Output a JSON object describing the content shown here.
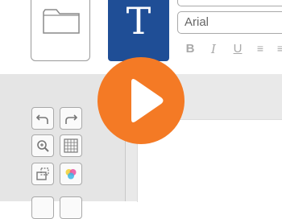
{
  "toolbar": {
    "font_name": "Arial",
    "text_tool_glyph": "T",
    "format": {
      "bold": "B",
      "italic": "I",
      "underline": "U",
      "align_left": "≡",
      "align_center": "≡"
    }
  },
  "icons": {
    "folder": "folder-icon",
    "undo": "undo-icon",
    "redo": "redo-icon",
    "zoom": "zoom-icon",
    "grid": "grid-icon",
    "crop": "crop-icon",
    "colors": "colors-icon",
    "play": "play-icon"
  },
  "colors": {
    "text_tool_bg": "#1f4e96",
    "play_button": "#f47a25",
    "sidebar_bg": "#e5e5e5"
  }
}
